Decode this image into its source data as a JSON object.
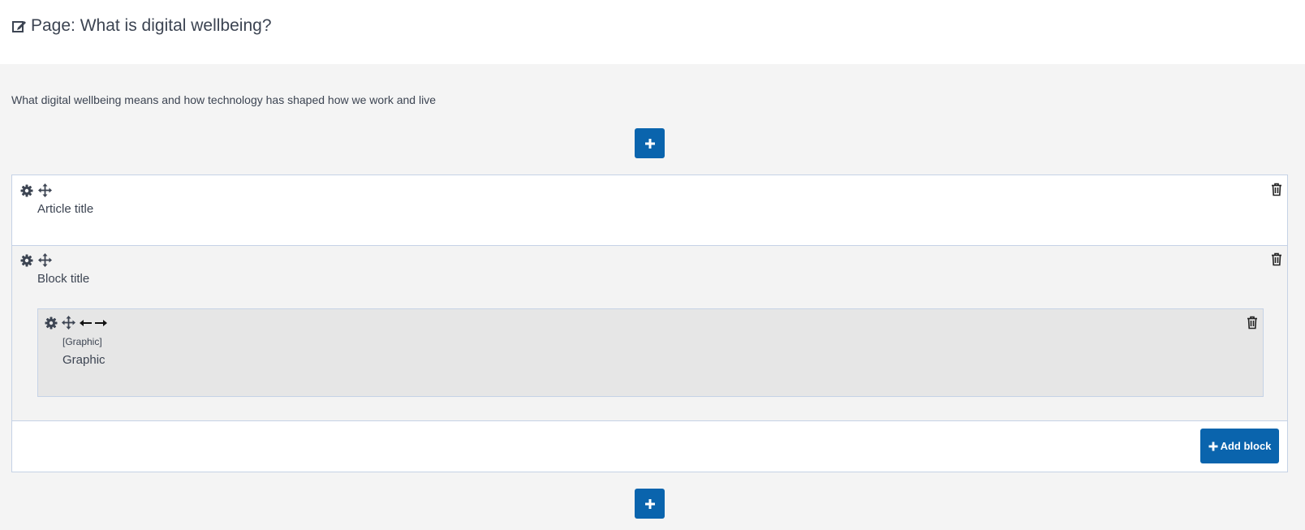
{
  "page": {
    "title": "Page: What is digital wellbeing?",
    "description": "What digital wellbeing means and how technology has shaped how we work and live"
  },
  "article": {
    "title": "Article title",
    "block": {
      "title": "Block title",
      "component": {
        "type": "[Graphic]",
        "title": "Graphic"
      }
    },
    "add_block_label": "Add block"
  },
  "colors": {
    "primary": "#0a64ad",
    "border": "#c5d2e6",
    "text": "#3c4452"
  },
  "icons": {
    "edit": "edit-icon",
    "add": "plus-icon",
    "settings": "gear-icon",
    "move": "move-icon",
    "resize": "left-right-arrows-icon",
    "delete": "trash-icon"
  }
}
